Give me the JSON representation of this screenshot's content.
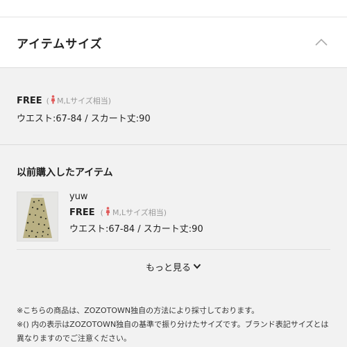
{
  "header": {
    "title": "アイテムサイズ",
    "toggle_icon": "chevron-up-icon"
  },
  "size": {
    "label": "FREE",
    "note_open": "(",
    "note_text": "M,Lサイズ相当)",
    "measurement": "ウエスト:67-84 / スカート丈:90"
  },
  "purchased": {
    "title": "以前購入したアイテム",
    "items": [
      {
        "brand": "yuw",
        "size_label": "FREE",
        "note_open": "(",
        "note_text": "M,Lサイズ相当)",
        "measurement": "ウエスト:67-84 / スカート丈:90"
      }
    ],
    "more_label": "もっと見る"
  },
  "notes": [
    "※こちらの商品は、ZOZOTOWN独自の方法により採寸しております。",
    "※() 内の表示はZOZOTOWN独自の基準で振り分けたサイズです。ブランド表記サイズとは異なりますのでご注意ください。"
  ],
  "colors": {
    "accent_person": "#e05a5a",
    "note_gray": "#999999"
  }
}
